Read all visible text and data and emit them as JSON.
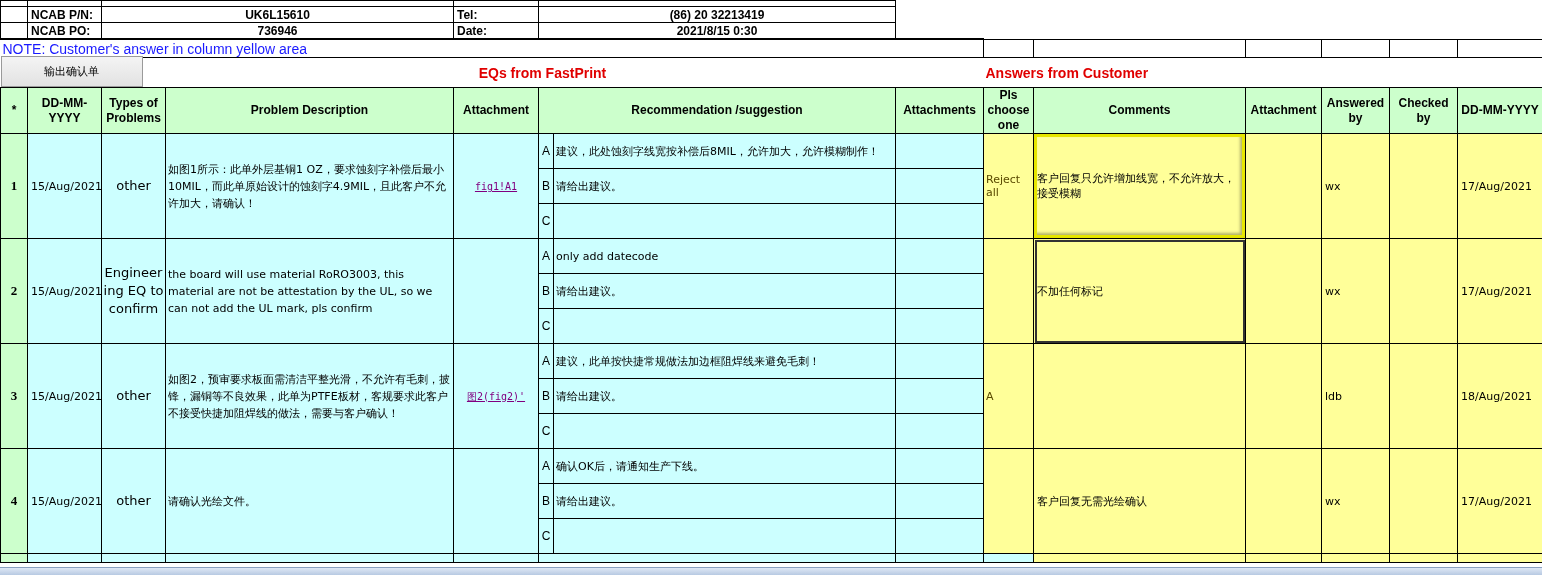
{
  "info_rows": [
    {
      "left_label": "NCAB P/N:",
      "left_value": "UK6L15610",
      "right_label": "Tel:",
      "right_value": "(86) 20 32213419"
    },
    {
      "left_label": "NCAB PO:",
      "left_value": "736946",
      "right_label": "Date:",
      "right_value": "2021/8/15 0:30"
    }
  ],
  "note": "NOTE: Customer's  answer in column yellow area",
  "export_button": "输出确认单",
  "eq_title": "EQs from FastPrint",
  "answers_title": "Answers from Customer",
  "columns": [
    "*",
    "DD-MM-YYYY",
    "Types of Problems",
    "Problem Description",
    "Attachment",
    "Recommendation /suggestion",
    "Attachments",
    "Pls choose one",
    "Comments",
    "Attachment",
    "Answered by",
    "Checked by",
    "DD-MM-YYYY"
  ],
  "rows": [
    {
      "number": "1",
      "date": "15/Aug/2021",
      "type": "other",
      "problem": "如图1所示：此单外层基铜1 OZ，要求蚀刻字补偿后最小10MIL，而此单原始设计的蚀刻字4.9MIL，且此客户不允许加大，请确认！",
      "attachment": "fig1!A1",
      "options": [
        {
          "letter": "A",
          "text": "建议，此处蚀刻字线宽按补偿后8MIL，允许加大，允许模糊制作！"
        },
        {
          "letter": "B",
          "text": "请给出建议。"
        },
        {
          "letter": "C"
        }
      ],
      "choice": "Reject all",
      "comments": "客户回复只允许增加线宽，不允许放大，接受模糊",
      "highlighted": true,
      "selected": false,
      "answered_by": "wx",
      "answer_date": "17/Aug/2021"
    },
    {
      "number": "2",
      "date": "15/Aug/2021",
      "type": "Engineering EQ to confirm",
      "problem": "the board will use material RoRO3003, this material are not be attestation by the UL, so we can not add the UL mark, pls confirm",
      "options": [
        {
          "letter": "A",
          "text": "only add datecode"
        },
        {
          "letter": "B",
          "text": "请给出建议。"
        },
        {
          "letter": "C"
        }
      ],
      "comments": "不加任何标记",
      "highlighted": false,
      "selected": true,
      "answered_by": "wx",
      "answer_date": "17/Aug/2021"
    },
    {
      "number": "3",
      "date": "15/Aug/2021",
      "type": "other",
      "problem": "如图2，预审要求板面需清洁平整光滑，不允许有毛刺，披锋，漏铜等不良效果，此单为PTFE板材，客规要求此客户不接受快捷加阻焊线的做法，需要与客户确认！",
      "attachment": "图2(fig2)'",
      "options": [
        {
          "letter": "A",
          "text": "建议，此单按快捷常规做法加边框阻焊线来避免毛刺！"
        },
        {
          "letter": "B",
          "text": "请给出建议。"
        },
        {
          "letter": "C"
        }
      ],
      "choice": "A",
      "highlighted": false,
      "selected": false,
      "answered_by": "ldb",
      "answer_date": "18/Aug/2021"
    },
    {
      "number": "4",
      "date": "15/Aug/2021",
      "type": "other",
      "problem": "请确认光绘文件。",
      "options": [
        {
          "letter": "A",
          "text": "确认OK后，请通知生产下线。"
        },
        {
          "letter": "B",
          "text": "请给出建议。"
        },
        {
          "letter": "C"
        }
      ],
      "comments": "客户回复无需光绘确认",
      "highlighted": false,
      "selected": false,
      "answered_by": "wx",
      "answer_date": "17/Aug/2021"
    }
  ]
}
